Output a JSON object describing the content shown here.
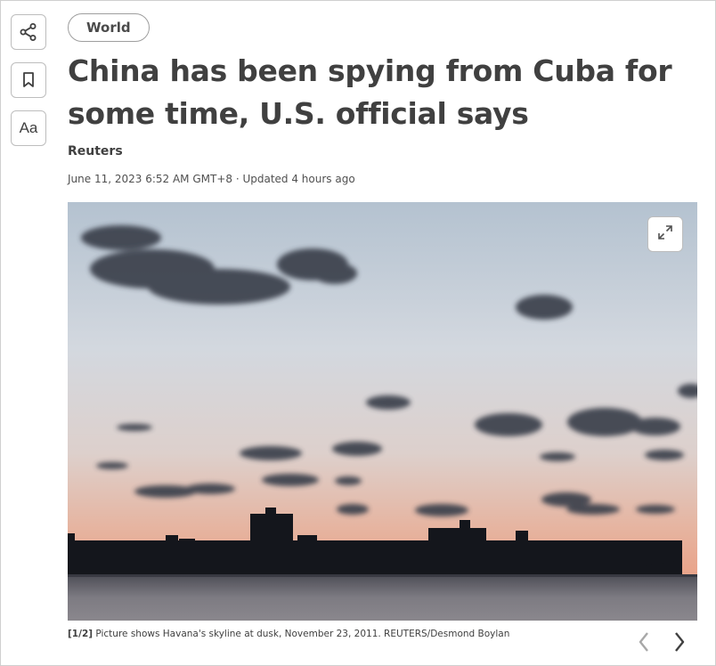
{
  "toolbar": {
    "share_icon": "share-icon",
    "bookmark_icon": "bookmark-icon",
    "text_size_label": "Aa"
  },
  "article": {
    "section": "World",
    "headline": "China has been spying from Cuba for some time, U.S. official says",
    "author": "Reuters",
    "dateline": "June 11, 2023 6:52 AM GMT+8 · Updated 4 hours ago"
  },
  "gallery": {
    "counter": "[1/2]",
    "caption": "Picture shows Havana's skyline at dusk, November 23, 2011. REUTERS/Desmond Boylan",
    "expand_icon": "expand-icon",
    "prev_icon": "chevron-left-icon",
    "next_icon": "chevron-right-icon"
  },
  "colors": {
    "text": "#404040",
    "border": "#bdbdbd",
    "sky_top": "#b9c7d4",
    "sky_horizon": "#e8a98e",
    "silhouette": "#14161c"
  }
}
